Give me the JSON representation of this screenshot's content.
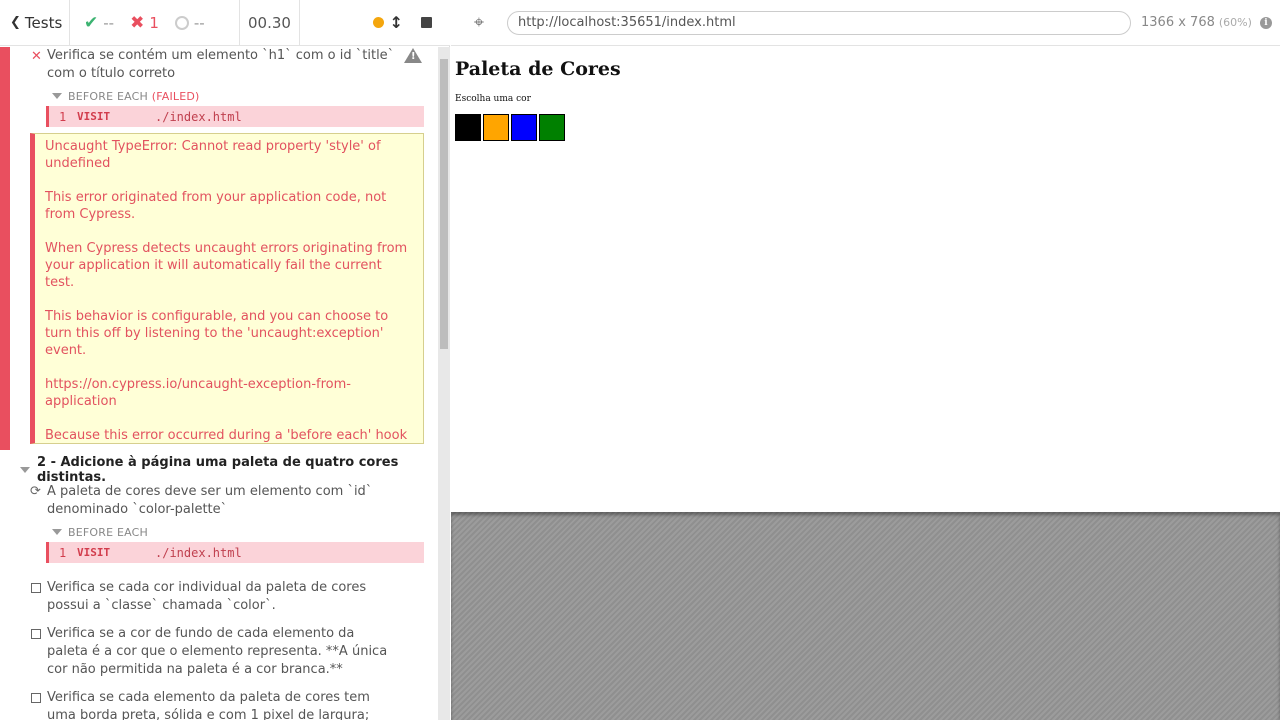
{
  "topbar": {
    "tests_label": "Tests",
    "passed": "--",
    "failed": "1",
    "pending": "--",
    "duration": "00.30"
  },
  "test1": {
    "title": "Verifica se contém um elemento `h1` com o id `title` com o título correto",
    "hook_label": "BEFORE EACH",
    "hook_status": "(FAILED)",
    "cmd_num": "1",
    "cmd_name": "VISIT",
    "cmd_msg": "./index.html"
  },
  "error": {
    "line1": "Uncaught TypeError: Cannot read property 'style' of undefined",
    "line2": "This error originated from your application code, not from Cypress.",
    "line3": "When Cypress detects uncaught errors originating from your application it will automatically fail the current test.",
    "line4": "This behavior is configurable, and you can choose to turn this off by listening to the 'uncaught:exception' event.",
    "line5": "https://on.cypress.io/uncaught-exception-from-application",
    "line6": "Because this error occurred during a 'before each' hook we are skipping the remaining tests in the current suite: '1 - Adicione à página o tít...'"
  },
  "suite2": {
    "title": "2 - Adicione à página uma paleta de quatro cores distintas.",
    "test_running": "A paleta de cores deve ser um elemento com `id` denominado `color-palette`",
    "hook_label": "BEFORE EACH",
    "cmd_num": "1",
    "cmd_name": "VISIT",
    "cmd_msg": "./index.html",
    "test2": "Verifica se cada cor individual da paleta de cores possui a `classe` chamada `color`.",
    "test3": "Verifica se a cor de fundo de cada elemento da paleta é a cor que o elemento representa. **A única cor não permitida na paleta é a cor branca.**",
    "test4": "Verifica se cada elemento da paleta de cores tem uma borda preta, sólida e com 1 pixel de largura;"
  },
  "aut": {
    "url": "http://localhost:35651/index.html",
    "viewport": "1366 x 768",
    "scale": "(60%)",
    "page_title": "Paleta de Cores",
    "page_subtitle": "Escolha uma cor",
    "colors": [
      "#000000",
      "#ffa500",
      "#0000ff",
      "#008000"
    ]
  },
  "status_colors": {
    "pass": "#3cb371",
    "fail": "#e94f5f",
    "running": "#f4a60d"
  }
}
